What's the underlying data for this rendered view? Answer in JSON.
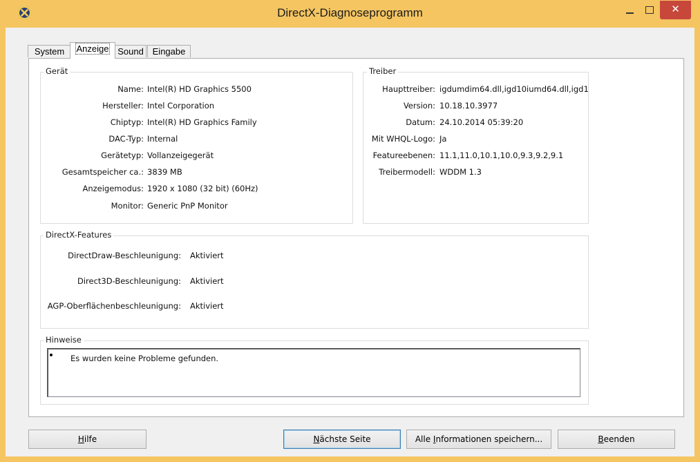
{
  "window": {
    "title": "DirectX-Diagnoseprogramm",
    "close_glyph": "✕",
    "icons": {
      "app": "directx-app-icon",
      "minimize": "minimize-icon",
      "maximize": "maximize-icon",
      "close": "close-icon"
    }
  },
  "tabs": [
    {
      "label": "System"
    },
    {
      "label": "Anzeige",
      "active": true
    },
    {
      "label": "Sound"
    },
    {
      "label": "Eingabe"
    }
  ],
  "device": {
    "title": "Gerät",
    "rows": [
      {
        "label": "Name:",
        "value": "Intel(R) HD Graphics 5500"
      },
      {
        "label": "Hersteller:",
        "value": "Intel Corporation"
      },
      {
        "label": "Chiptyp:",
        "value": "Intel(R) HD Graphics Family"
      },
      {
        "label": "DAC-Typ:",
        "value": "Internal"
      },
      {
        "label": "Gerätetyp:",
        "value": "Vollanzeigegerät"
      },
      {
        "label": "Gesamtspeicher ca.:",
        "value": "3839 MB"
      },
      {
        "label": "Anzeigemodus:",
        "value": "1920 x 1080 (32 bit) (60Hz)"
      },
      {
        "label": "Monitor:",
        "value": "Generic PnP Monitor"
      }
    ]
  },
  "driver": {
    "title": "Treiber",
    "rows": [
      {
        "label": "Haupttreiber:",
        "value": "igdumdim64.dll,igd10iumd64.dll,igd1"
      },
      {
        "label": "Version:",
        "value": "10.18.10.3977"
      },
      {
        "label": "Datum:",
        "value": "24.10.2014 05:39:20"
      },
      {
        "label": "Mit WHQL-Logo:",
        "value": "Ja"
      },
      {
        "label": "Featureebenen:",
        "value": "11.1,11.0,10.1,10.0,9.3,9.2,9.1"
      },
      {
        "label": "Treibermodell:",
        "value": "WDDM 1.3"
      }
    ]
  },
  "features": {
    "title": "DirectX-Features",
    "rows": [
      {
        "label": "DirectDraw-Beschleunigung:",
        "value": "Aktiviert"
      },
      {
        "label": "Direct3D-Beschleunigung:",
        "value": "Aktiviert"
      },
      {
        "label": "AGP-Oberflächenbeschleunigung:",
        "value": "Aktiviert"
      }
    ]
  },
  "notes": {
    "title": "Hinweise",
    "items": [
      "Es wurden keine Probleme gefunden."
    ]
  },
  "buttons": {
    "help": {
      "before": "",
      "accel": "H",
      "after": "ilfe"
    },
    "next": {
      "before": "",
      "accel": "N",
      "after": "ächste Seite"
    },
    "save": {
      "before": "Alle ",
      "accel": "I",
      "after": "nformationen speichern..."
    },
    "exit": {
      "before": "",
      "accel": "B",
      "after": "eenden"
    }
  }
}
